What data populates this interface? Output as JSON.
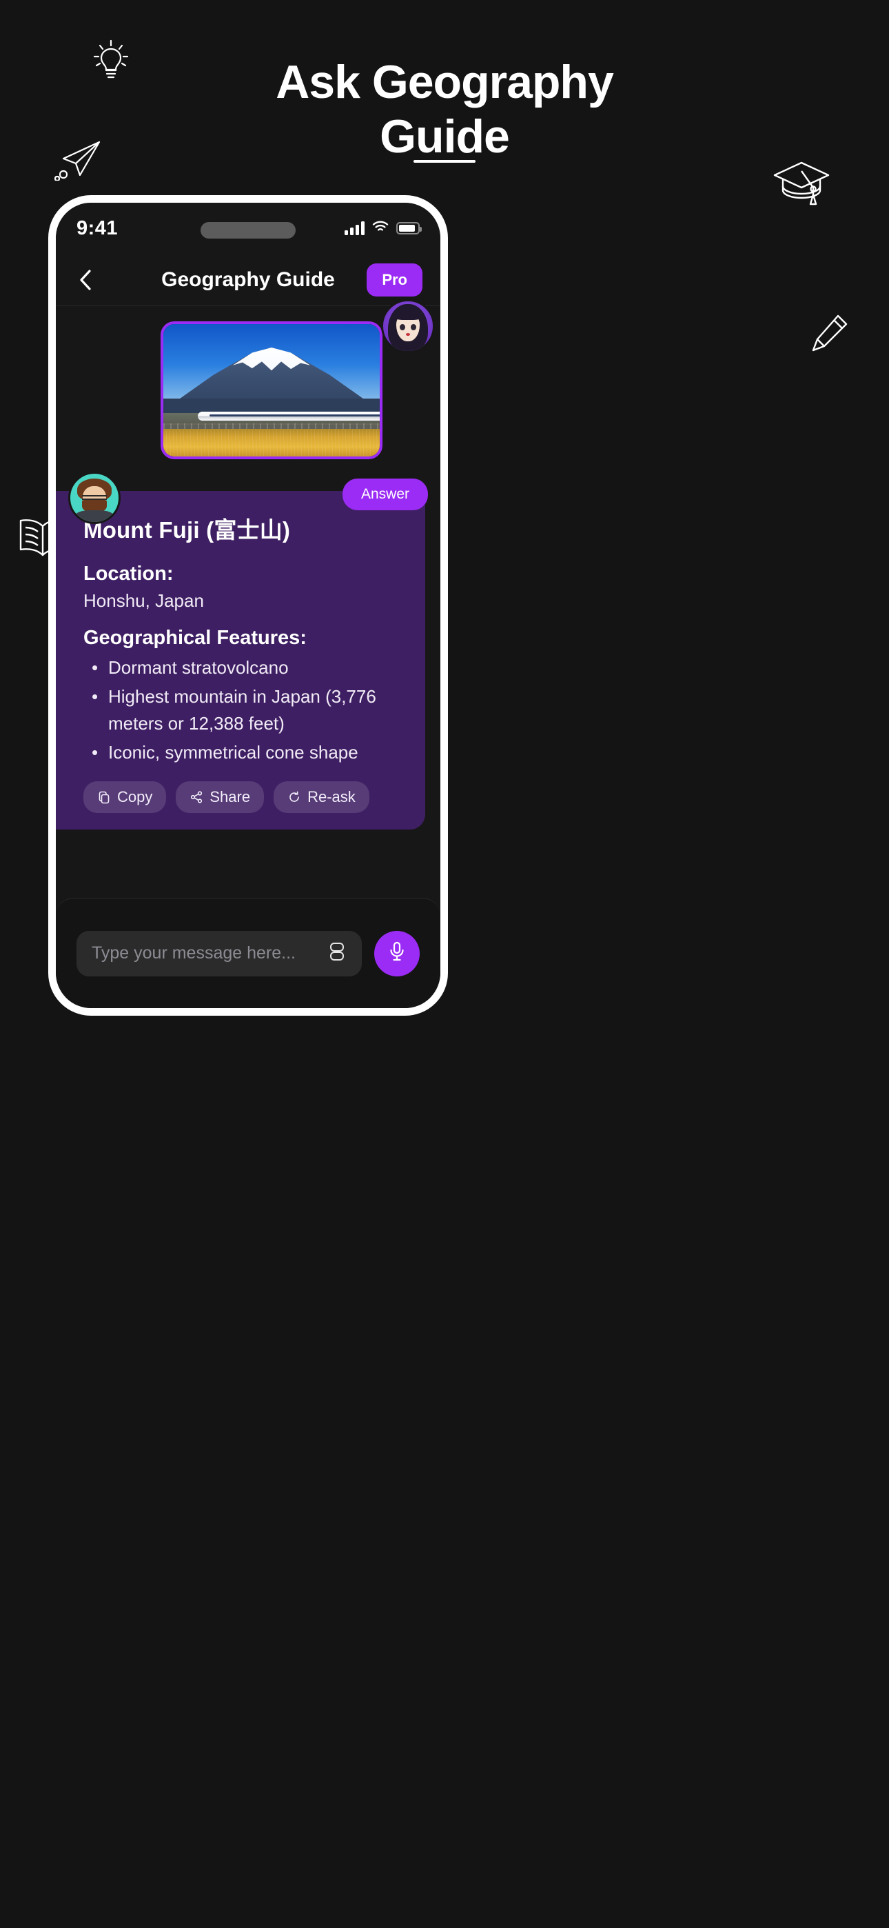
{
  "promo": {
    "title_line1": "Ask Geography",
    "title_line2": "Guide",
    "doodles": [
      {
        "name": "lightbulb-icon"
      },
      {
        "name": "graduation-cap-icon"
      },
      {
        "name": "paper-plane-icon"
      },
      {
        "name": "pencil-icon"
      },
      {
        "name": "open-book-icon"
      }
    ]
  },
  "status_bar": {
    "time": "9:41",
    "cellular_icon": "signal-bars-icon",
    "wifi_icon": "wifi-icon",
    "battery_icon": "battery-icon"
  },
  "nav": {
    "back_icon": "chevron-left-icon",
    "title": "Geography Guide",
    "pro_label": "Pro"
  },
  "hero": {
    "image_alt": "Mount Fuji with Shinkansen bullet train and golden field",
    "border_color": "#9B2CF5",
    "assistant_avatar": "assistant-avatar"
  },
  "answer": {
    "badge": "Answer",
    "user_avatar": "user-avatar",
    "title": "Mount Fuji (富士山)",
    "location_heading": "Location:",
    "location_value": "Honshu, Japan",
    "features_heading": "Geographical Features:",
    "features": [
      "Dormant stratovolcano",
      "Highest mountain in Japan (3,776 meters or 12,388 feet)",
      "Iconic, symmetrical cone shape"
    ],
    "actions": [
      {
        "label": "Copy",
        "icon": "copy-icon"
      },
      {
        "label": "Share",
        "icon": "share-icon"
      },
      {
        "label": "Re-ask",
        "icon": "refresh-icon"
      }
    ],
    "card_color": "#3F1F63"
  },
  "composer": {
    "placeholder": "Type your message here...",
    "value": "",
    "attach_icon": "card-stack-icon",
    "mic_icon": "microphone-icon",
    "mic_color": "#9B2CF5"
  }
}
